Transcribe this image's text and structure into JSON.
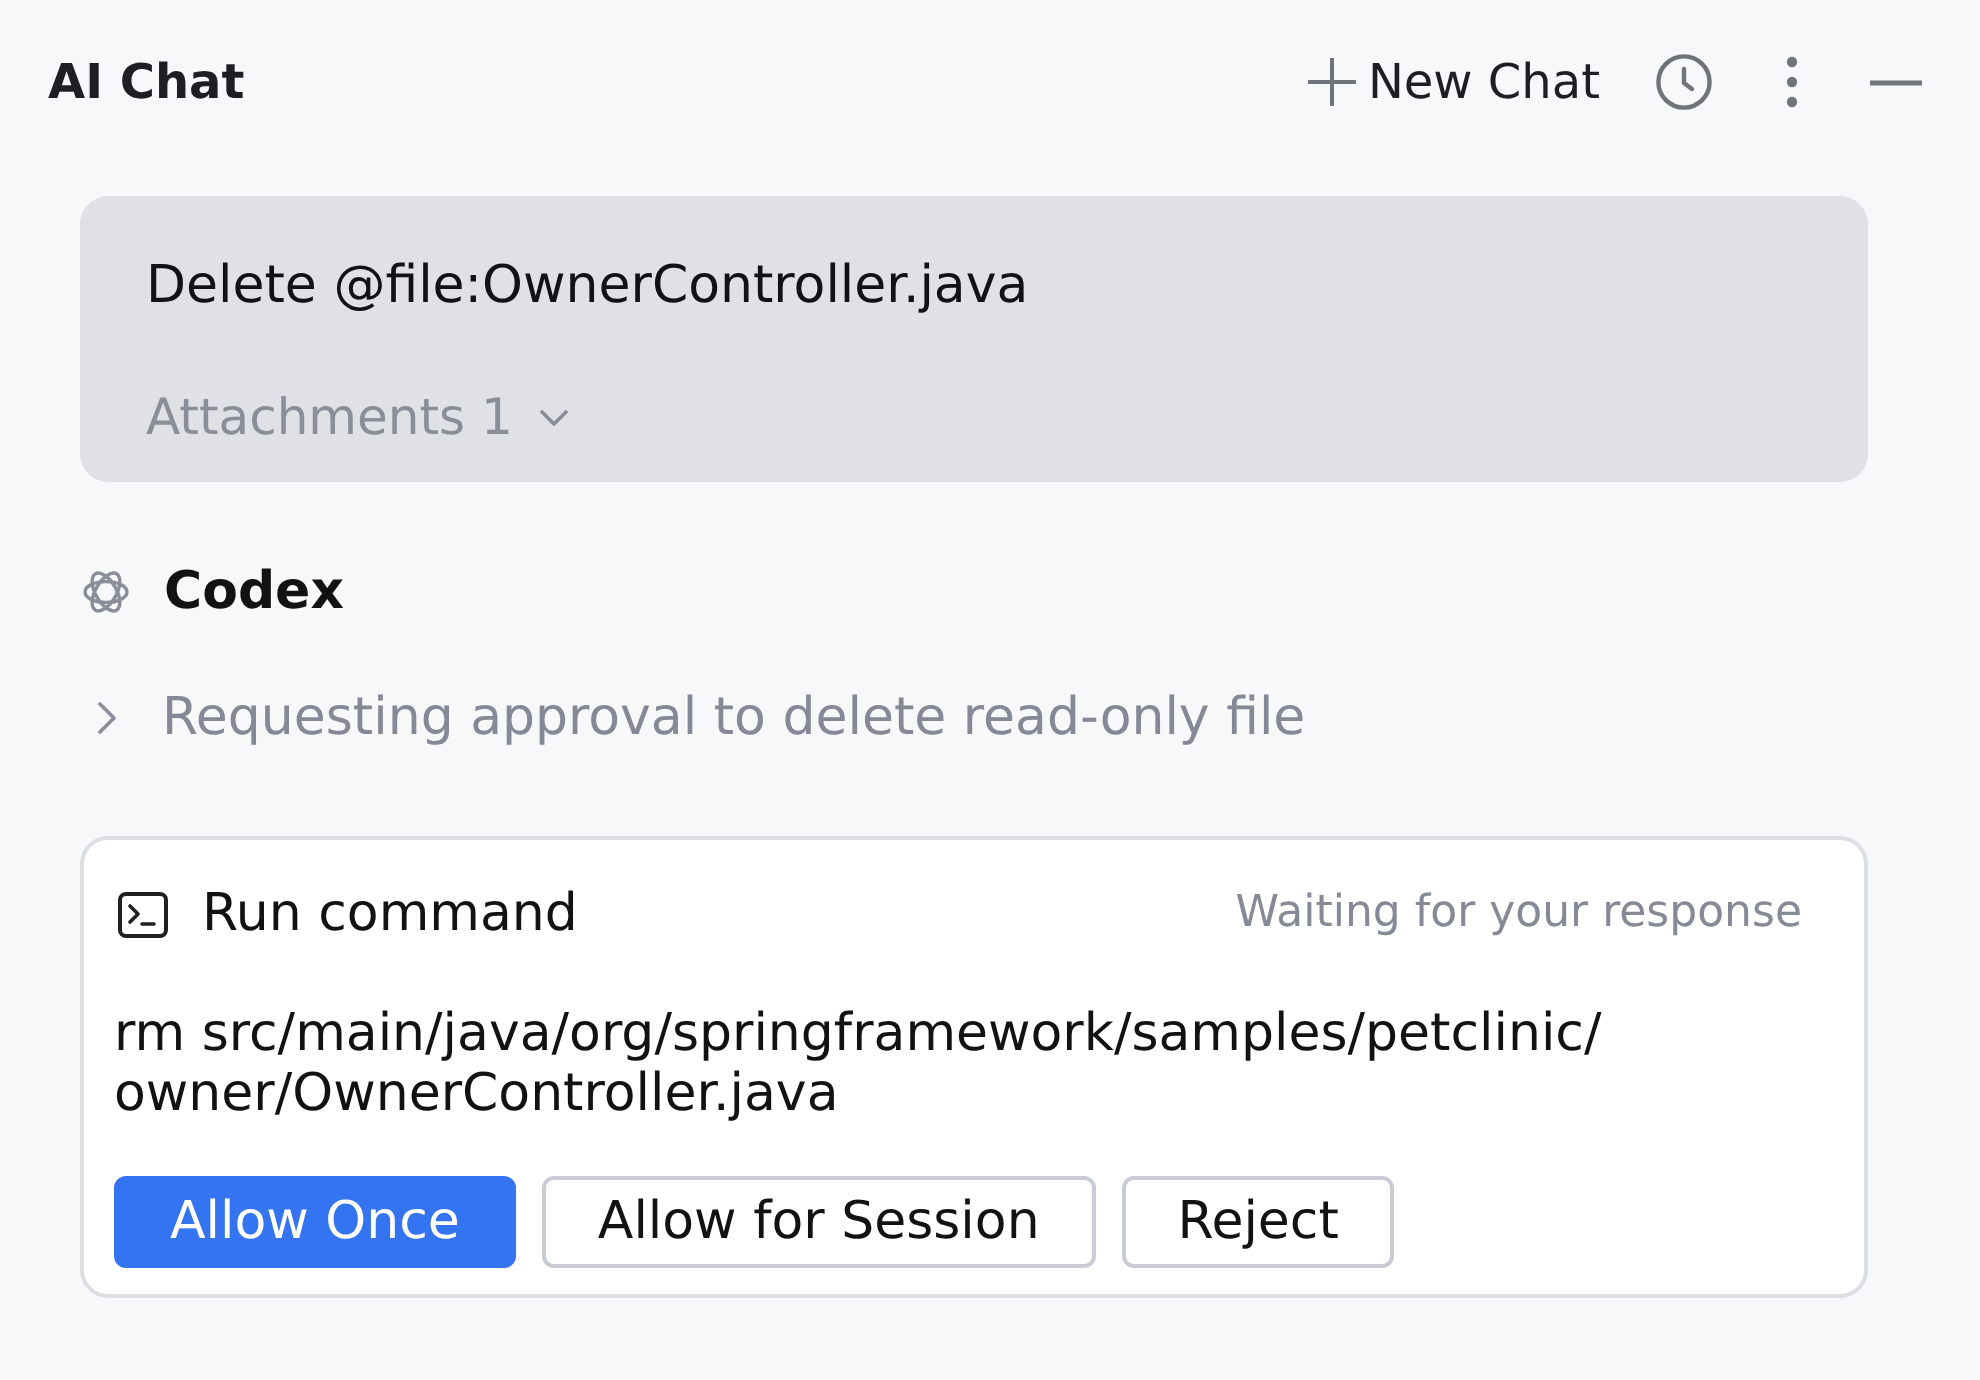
{
  "panel": {
    "title": "AI Chat"
  },
  "toolbar": [
    {
      "kind": "new",
      "label": "New Chat"
    },
    {
      "kind": "history"
    },
    {
      "kind": "more"
    },
    {
      "kind": "minimize"
    }
  ],
  "user_message": {
    "text": "Delete @file:OwnerController.java",
    "attachments_label": "Attachments 1"
  },
  "agent": {
    "name": "Codex"
  },
  "step": {
    "text": "Requesting approval to delete read-only file",
    "expanded": false
  },
  "approval_card": {
    "title": "Run command",
    "status": "Waiting for your response",
    "command": "rm src/main/java/org/springframework/samples/petclinic/owner/OwnerController.java",
    "buttons": [
      {
        "label": "Allow Once",
        "kind": "primary"
      },
      {
        "label": "Allow for Session",
        "kind": "secondary"
      },
      {
        "label": "Reject",
        "kind": "secondary"
      }
    ]
  }
}
